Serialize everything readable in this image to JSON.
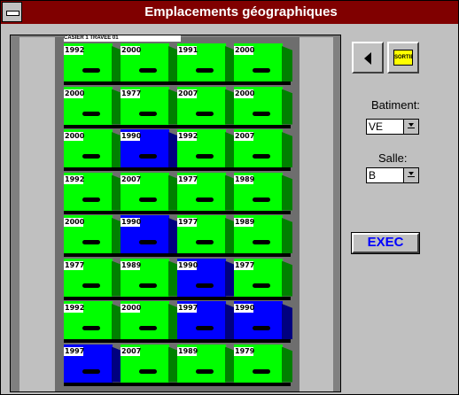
{
  "window": {
    "title": "Emplacements géographiques"
  },
  "cabinet": {
    "label": "CASIER 1 TRAVEE 01",
    "rows": [
      [
        {
          "year": "1992",
          "color": "green"
        },
        {
          "year": "2000",
          "color": "green"
        },
        {
          "year": "1991",
          "color": "green"
        },
        {
          "year": "2000",
          "color": "green"
        }
      ],
      [
        {
          "year": "2000",
          "color": "green"
        },
        {
          "year": "1977",
          "color": "green"
        },
        {
          "year": "2007",
          "color": "green"
        },
        {
          "year": "2000",
          "color": "green"
        }
      ],
      [
        {
          "year": "2000",
          "color": "green"
        },
        {
          "year": "1990",
          "color": "blue"
        },
        {
          "year": "1992",
          "color": "green"
        },
        {
          "year": "2007",
          "color": "green"
        }
      ],
      [
        {
          "year": "1992",
          "color": "green"
        },
        {
          "year": "2007",
          "color": "green"
        },
        {
          "year": "1977",
          "color": "green"
        },
        {
          "year": "1989",
          "color": "green"
        }
      ],
      [
        {
          "year": "2000",
          "color": "green"
        },
        {
          "year": "1990",
          "color": "blue"
        },
        {
          "year": "1977",
          "color": "green"
        },
        {
          "year": "1989",
          "color": "green"
        }
      ],
      [
        {
          "year": "1977",
          "color": "green"
        },
        {
          "year": "1989",
          "color": "green"
        },
        {
          "year": "1990",
          "color": "blue"
        },
        {
          "year": "1977",
          "color": "green"
        }
      ],
      [
        {
          "year": "1992",
          "color": "green"
        },
        {
          "year": "2000",
          "color": "green"
        },
        {
          "year": "1997",
          "color": "blue"
        },
        {
          "year": "1990",
          "color": "blue"
        }
      ],
      [
        {
          "year": "1997",
          "color": "blue"
        },
        {
          "year": "2007",
          "color": "green"
        },
        {
          "year": "1989",
          "color": "green"
        },
        {
          "year": "1979",
          "color": "green"
        }
      ]
    ]
  },
  "controls": {
    "prev_icon": "arrow-left-icon",
    "sortie_label": "SORTIE",
    "batiment_label": "Batiment:",
    "batiment_value": "VE",
    "salle_label": "Salle:",
    "salle_value": "B",
    "exec_label": "EXEC"
  },
  "colors": {
    "title_bar": "#800000",
    "box_green": "#00ff00",
    "box_blue": "#0000ff",
    "exec_text": "#0000ff"
  }
}
